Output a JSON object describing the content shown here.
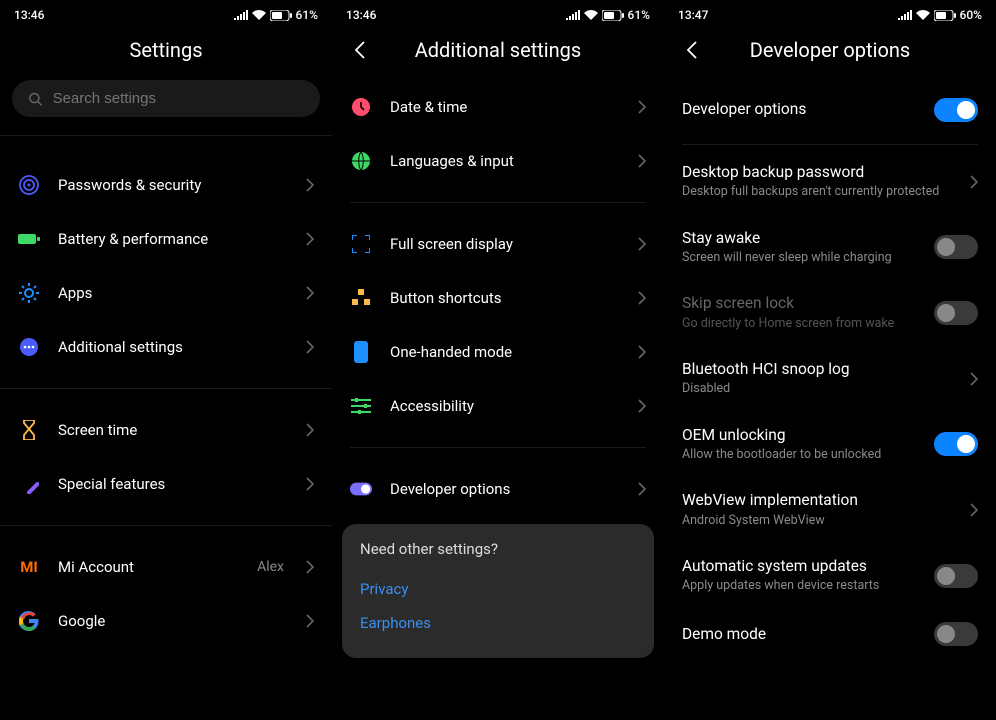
{
  "pane1": {
    "time": "13:46",
    "battery": "61",
    "title": "Settings",
    "search_placeholder": "Search settings",
    "items": [
      {
        "label": "Passwords & security"
      },
      {
        "label": "Battery & performance"
      },
      {
        "label": "Apps"
      },
      {
        "label": "Additional settings"
      }
    ],
    "items2": [
      {
        "label": "Screen time"
      },
      {
        "label": "Special features"
      }
    ],
    "items3": [
      {
        "label": "Mi Account",
        "value": "Alex"
      },
      {
        "label": "Google"
      }
    ]
  },
  "pane2": {
    "time": "13:46",
    "battery": "61",
    "title": "Additional settings",
    "group1": [
      {
        "label": "Date & time"
      },
      {
        "label": "Languages & input"
      }
    ],
    "group2": [
      {
        "label": "Full screen display"
      },
      {
        "label": "Button shortcuts"
      },
      {
        "label": "One-handed mode"
      },
      {
        "label": "Accessibility"
      }
    ],
    "group3": [
      {
        "label": "Developer options"
      }
    ],
    "card": {
      "question": "Need other settings?",
      "links": [
        "Privacy",
        "Earphones"
      ]
    }
  },
  "pane3": {
    "time": "13:47",
    "battery": "60",
    "title": "Developer options",
    "toggle_main": {
      "title": "Developer options",
      "on": true
    },
    "rows": [
      {
        "title": "Desktop backup password",
        "sub": "Desktop full backups aren't currently protected",
        "type": "chevron"
      },
      {
        "title": "Stay awake",
        "sub": "Screen will never sleep while charging",
        "type": "toggle",
        "on": false
      },
      {
        "title": "Skip screen lock",
        "sub": "Go directly to Home screen from wake",
        "type": "toggle",
        "on": false,
        "disabled": true
      },
      {
        "title": "Bluetooth HCI snoop log",
        "sub": "Disabled",
        "type": "chevron"
      },
      {
        "title": "OEM unlocking",
        "sub": "Allow the bootloader to be unlocked",
        "type": "toggle",
        "on": true
      },
      {
        "title": "WebView implementation",
        "sub": "Android System WebView",
        "type": "chevron"
      },
      {
        "title": "Automatic system updates",
        "sub": "Apply updates when device restarts",
        "type": "toggle",
        "on": false
      },
      {
        "title": "Demo mode",
        "type": "toggle",
        "on": false
      }
    ]
  }
}
